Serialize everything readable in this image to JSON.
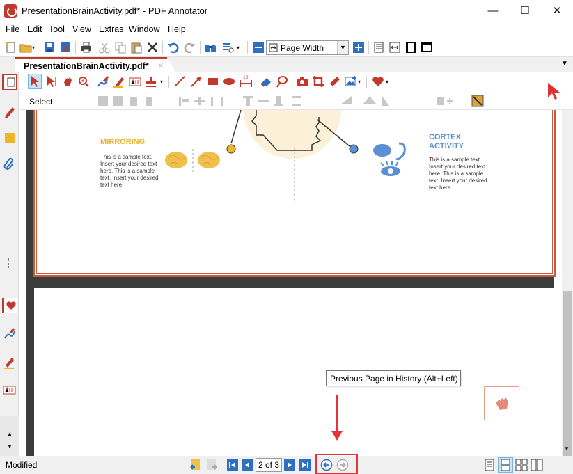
{
  "window": {
    "title": "PresentationBrainActivity.pdf* - PDF Annotator",
    "minimize": "—",
    "maximize": "☐",
    "close": "✕"
  },
  "menu": {
    "items": [
      {
        "label": "File",
        "key": "F",
        "rest": "ile"
      },
      {
        "label": "Edit",
        "key": "E",
        "rest": "dit"
      },
      {
        "label": "Tool",
        "key": "T",
        "rest": "ool"
      },
      {
        "label": "View",
        "key": "V",
        "rest": "iew"
      },
      {
        "label": "Extras",
        "key": "E",
        "rest": "xtras"
      },
      {
        "label": "Window",
        "key": "W",
        "rest": "indow"
      },
      {
        "label": "Help",
        "key": "H",
        "rest": "elp"
      }
    ]
  },
  "toolbar": {
    "zoom_value": "Page Width"
  },
  "tabs": {
    "active_label": "PresentationBrainActivity.pdf*",
    "close": "✕",
    "dropdown": "▼"
  },
  "tools": {
    "current_tool": "Select"
  },
  "document": {
    "page1": {
      "mirroring_heading": "MIRRORING",
      "mirroring_text": "This is a sample text. Insert your desired text here. This is a sample text. Insert your desired text here.",
      "cortex_heading": "CORTEX ACTIVITY",
      "cortex_text": "This is a sample text. Insert your desired text here. This is a sample text. Insert your desired text here."
    }
  },
  "tooltip": {
    "text": "Previous Page in History (Alt+Left)"
  },
  "status": {
    "state": "Modified",
    "page_indicator": "2 of 3"
  },
  "colors": {
    "accent": "#c0392b",
    "mirror": "#f0b429",
    "cortex": "#5b8fd4",
    "nav_blue": "#2f6fc0",
    "highlight": "#e2343b"
  }
}
